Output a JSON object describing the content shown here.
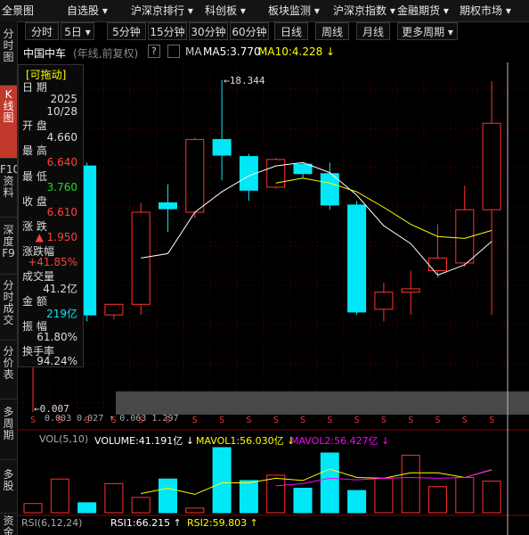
{
  "top_menu": [
    "全景图",
    "自选股 ▾",
    "沪深京排行 ▾",
    "科创板 ▾",
    "板块监测 ▾",
    "沪深京指数 ▾",
    "金融期货 ▾",
    "期权市场 ▾"
  ],
  "side_tabs": [
    {
      "label": "分时图",
      "active": false
    },
    {
      "label": "K线图",
      "active": true
    },
    {
      "label": "F10资料",
      "active": false
    },
    {
      "label": "深度F9",
      "active": false
    },
    {
      "label": "分时成交",
      "active": false
    },
    {
      "label": "分价表",
      "active": false
    },
    {
      "label": "多周期",
      "active": false
    },
    {
      "label": "多股",
      "active": false
    },
    {
      "label": "资金",
      "active": false
    }
  ],
  "periods": [
    "分时",
    "5日 ▾",
    "5分钟",
    "15分钟",
    "30分钟",
    "60分钟",
    "日线",
    "周线",
    "月线",
    "更多周期 ▾"
  ],
  "info": {
    "stock_name": "中国中车",
    "mode": "(年线,前复权)",
    "help": "?",
    "ma_label": "MA",
    "ma5": "MA5:3.770",
    "ma10": "MA10:4.228 ↓"
  },
  "panel": {
    "title": "[可拖动]",
    "date_label": "日  期",
    "year": "2025",
    "date": "10/28",
    "open_label": "开  盘",
    "open": "4.660",
    "high_label": "最  高",
    "high": "6.640",
    "low_label": "最  低",
    "low": "3.760",
    "close_label": "收  盘",
    "close": "6.610",
    "change_label": "涨  跌",
    "change": "▲ 1.950",
    "pct_label": "涨跌幅",
    "pct": "+41.85%",
    "volume_label": "成交量",
    "volume": "41.2亿",
    "amount_label": "金  额",
    "amount": "219亿",
    "amplitude_label": "振  幅",
    "amplitude": "61.80%",
    "turnover_label": "换手率",
    "turnover": "94.24%"
  },
  "annotations": {
    "max_label": "18.344",
    "min_label": "0.007",
    "lows_text": "0.003 0.027 ↑ 0.063 1.297"
  },
  "volume_indicator": {
    "name": "VOL(5,10)",
    "volume": "VOLUME:41.191亿 ↓",
    "mavol1": "MAVOL1:56.030亿 ↓",
    "mavol2": "MAVOL2:56.427亿 ↓"
  },
  "rsi_indicator": {
    "name": "RSI(6,12,24)",
    "rsi1": "RSI1:66.215 ↑",
    "rsi2": "RSI2:59.803 ↑"
  },
  "colors": {
    "up": "#ff3232",
    "down": "#00e8f8",
    "ma5": "#ffffff",
    "ma10": "#ffff00",
    "mavol2": "#ff00ff",
    "accent": "#c0392b"
  },
  "chart_data": {
    "type": "candlestick",
    "price_axis": "log",
    "grid": true,
    "candles": [
      {
        "o": 0.1,
        "h": 0.15,
        "l": 0.007,
        "c": 0.15
      },
      {
        "o": 0.15,
        "h": 2.45,
        "l": 0.03,
        "c": 2.4
      },
      {
        "o": 2.4,
        "h": 2.6,
        "l": 0.06,
        "c": 0.07
      },
      {
        "o": 0.07,
        "h": 0.09,
        "l": 0.063,
        "c": 0.09
      },
      {
        "o": 0.09,
        "h": 1.0,
        "l": 0.07,
        "c": 0.8
      },
      {
        "o": 1.0,
        "h": 1.55,
        "l": 0.5,
        "c": 0.87
      },
      {
        "o": 0.8,
        "h": 4.7,
        "l": 0.7,
        "c": 4.5
      },
      {
        "o": 4.5,
        "h": 18.344,
        "l": 1.7,
        "c": 3.1
      },
      {
        "o": 3.0,
        "h": 3.2,
        "l": 1.05,
        "c": 1.35
      },
      {
        "o": 1.45,
        "h": 2.9,
        "l": 1.4,
        "c": 2.8
      },
      {
        "o": 2.5,
        "h": 2.6,
        "l": 1.8,
        "c": 2.0
      },
      {
        "o": 2.0,
        "h": 2.6,
        "l": 0.85,
        "c": 0.95
      },
      {
        "o": 0.95,
        "h": 1.05,
        "l": 0.07,
        "c": 0.075
      },
      {
        "o": 0.08,
        "h": 0.15,
        "l": 0.06,
        "c": 0.12
      },
      {
        "o": 0.12,
        "h": 0.2,
        "l": 0.07,
        "c": 0.13
      },
      {
        "o": 0.2,
        "h": 0.6,
        "l": 0.17,
        "c": 0.27
      },
      {
        "o": 0.24,
        "h": 1.5,
        "l": 0.22,
        "c": 0.85
      },
      {
        "o": 0.85,
        "h": 18.0,
        "l": 0.07,
        "c": 6.61
      }
    ],
    "ma5": [
      null,
      null,
      null,
      null,
      0.27,
      0.3,
      0.8,
      1.3,
      1.9,
      2.4,
      2.6,
      2.05,
      1.2,
      0.58,
      0.38,
      0.18,
      0.23,
      0.4
    ],
    "ma10": [
      null,
      null,
      null,
      null,
      null,
      null,
      null,
      null,
      null,
      1.6,
      1.8,
      1.6,
      1.3,
      0.9,
      0.6,
      0.45,
      0.43,
      0.52
    ],
    "volume": [
      12,
      44,
      13,
      38,
      20,
      44,
      6,
      85,
      42,
      49,
      32,
      78,
      29,
      45,
      75,
      34,
      46,
      41.2
    ],
    "mavol1": [
      null,
      null,
      null,
      null,
      25,
      32,
      24,
      39,
      39,
      45,
      42,
      57,
      46,
      45,
      52,
      52,
      46,
      56.03
    ],
    "mavol2": [
      null,
      null,
      null,
      null,
      null,
      null,
      null,
      null,
      null,
      35,
      38,
      45,
      43,
      45,
      46,
      45,
      46,
      56.43
    ]
  }
}
